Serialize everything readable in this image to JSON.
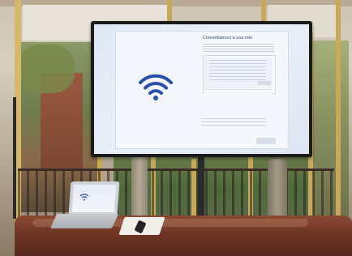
{
  "tv_screen": {
    "setup_title": "Connettiamoci a una rete",
    "wifi_icon": "wifi-icon"
  },
  "colors": {
    "wifi_icon": "#2a4fa8",
    "screen_background": "#e7eef8",
    "table_wood": "#7a3f2a"
  }
}
